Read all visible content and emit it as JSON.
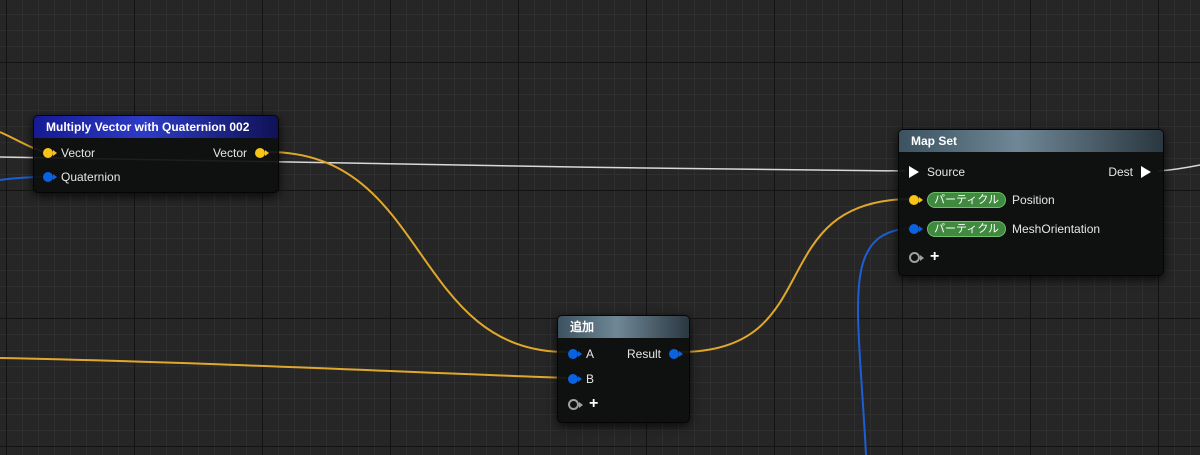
{
  "graph": {
    "colors": {
      "vector_wire": "#e0a82b",
      "quaternion_wire": "#1c5fd4",
      "parameter_wire": "#d9d9d9",
      "vector_pin": "#f7c417",
      "quaternion_pin": "#0a62e0",
      "namespace_badge": "#3f8a3f"
    },
    "nodes": {
      "multiply": {
        "title": "Multiply Vector with Quaternion 002",
        "inputs": [
          {
            "label": "Vector",
            "type": "vector"
          },
          {
            "label": "Quaternion",
            "type": "quaternion"
          }
        ],
        "output": {
          "label": "Vector",
          "type": "vector"
        }
      },
      "add": {
        "title": "追加",
        "inputs": [
          {
            "label": "A",
            "type": "wildcard"
          },
          {
            "label": "B",
            "type": "wildcard"
          }
        ],
        "output": {
          "label": "Result",
          "type": "wildcard"
        },
        "add_pin_symbol": "+"
      },
      "mapset": {
        "title": "Map Set",
        "source_label": "Source",
        "dest_label": "Dest",
        "inputs": [
          {
            "namespace": "パーティクル",
            "label": "Position",
            "type": "vector"
          },
          {
            "namespace": "パーティクル",
            "label": "MeshOrientation",
            "type": "quaternion"
          }
        ],
        "add_pin_symbol": "+"
      }
    }
  }
}
